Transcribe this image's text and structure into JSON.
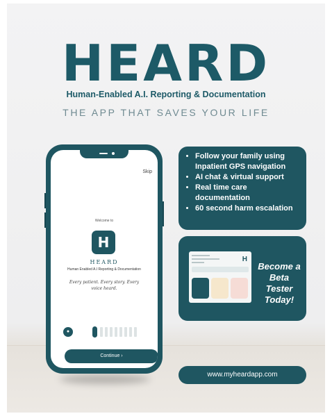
{
  "logo": {
    "wordmark": "HEARD",
    "subtitle": "Human-Enabled A.I. Reporting & Documentation",
    "tagline": "THE APP THAT SAVES YOUR LIFE"
  },
  "phone_screen": {
    "skip_label": "Skip",
    "welcome": "Welcome to",
    "app_icon_letter": "H",
    "app_name": "HEARD",
    "app_subtitle": "Human Enabled A.I Reporting & Documentation",
    "slogan": "Every patient. Every story. Every voice heard.",
    "continue_label": "Continue  ›",
    "pager_total": 9,
    "pager_active": 1
  },
  "features": [
    "Follow your family using Inpatient GPS navigation",
    "AI chat & virtual support",
    "Real time care documentation",
    "60 second harm escalation"
  ],
  "beta": {
    "text": "Become a Beta Tester Today!"
  },
  "website": {
    "url": "www.myheardapp.com"
  },
  "colors": {
    "brand_teal": "#1f5661",
    "logo_teal": "#1d5a67",
    "tagline_gray": "#6f8a91"
  },
  "icons": [
    "continue-chevron-icon",
    "lock-icon",
    "app-logo-icon"
  ]
}
